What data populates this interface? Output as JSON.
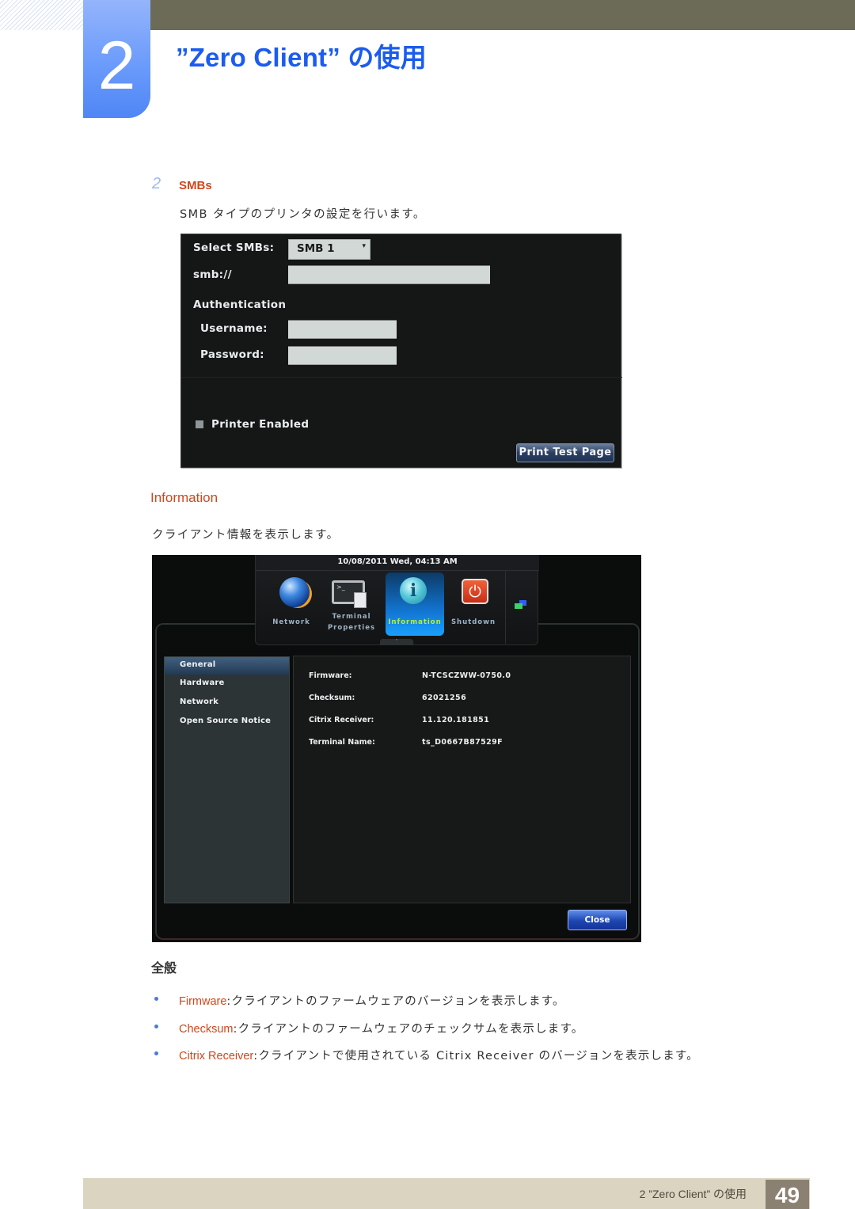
{
  "header": {
    "chapter_number": "2",
    "title": "”Zero Client” の使用"
  },
  "smbs_section": {
    "step_number": "2",
    "heading": "SMBs",
    "description": "SMB タイプのプリンタの設定を行います。",
    "panel": {
      "select_label": "Select SMBs:",
      "select_value": "SMB 1",
      "smb_label": "smb://",
      "smb_value": "",
      "auth_label": "Authentication",
      "username_label": "Username:",
      "username_value": "",
      "password_label": "Password:",
      "password_value": "",
      "printer_enabled_label": "Printer Enabled",
      "printer_enabled_checked": false,
      "print_test_page_label": "Print Test Page"
    }
  },
  "information_section": {
    "heading": "Information",
    "description": "クライアント情報を表示します。",
    "screen": {
      "datetime": "10/08/2011 Wed, 04:13 AM",
      "launcher": [
        {
          "label": "Network",
          "icon": "globe-icon"
        },
        {
          "label_line1": "Terminal",
          "label_line2": "Properties",
          "icon": "terminal-icon"
        },
        {
          "label": "Information",
          "icon": "info-icon",
          "active": true
        },
        {
          "label": "Shutdown",
          "icon": "power-icon"
        }
      ],
      "handle_glyph": "˄",
      "nav_items": [
        "General",
        "Hardware",
        "Network",
        "Open Source Notice"
      ],
      "selected_nav": "General",
      "details": [
        {
          "key": "Firmware:",
          "value": "N-TCSCZWW-0750.0"
        },
        {
          "key": "Checksum:",
          "value": "62021256"
        },
        {
          "key": "Citrix Receiver:",
          "value": "11.120.181851"
        },
        {
          "key": "Terminal Name:",
          "value": "ts_D0667B87529F"
        }
      ],
      "close_label": "Close"
    }
  },
  "general_section": {
    "heading": "全般",
    "bullets": [
      {
        "term": "Firmware",
        "text": ":クライアントのファームウェアのバージョンを表示します。"
      },
      {
        "term": "Checksum",
        "text": ":クライアントのファームウェアのチェックサムを表示します。"
      },
      {
        "term": "Citrix Receiver",
        "text": ":クライアントで使用されている Citrix Receiver のバージョンを表示します。"
      }
    ]
  },
  "footer": {
    "chapter_title": "2 ”Zero Client” の使用",
    "page_number": "49"
  },
  "colors": {
    "title_blue": "#1b5cf0",
    "heading_orange": "#d0471a",
    "header_band": "#6c6b58",
    "footer_band": "#dbd4c0",
    "page_num_bg": "#8b8172"
  }
}
